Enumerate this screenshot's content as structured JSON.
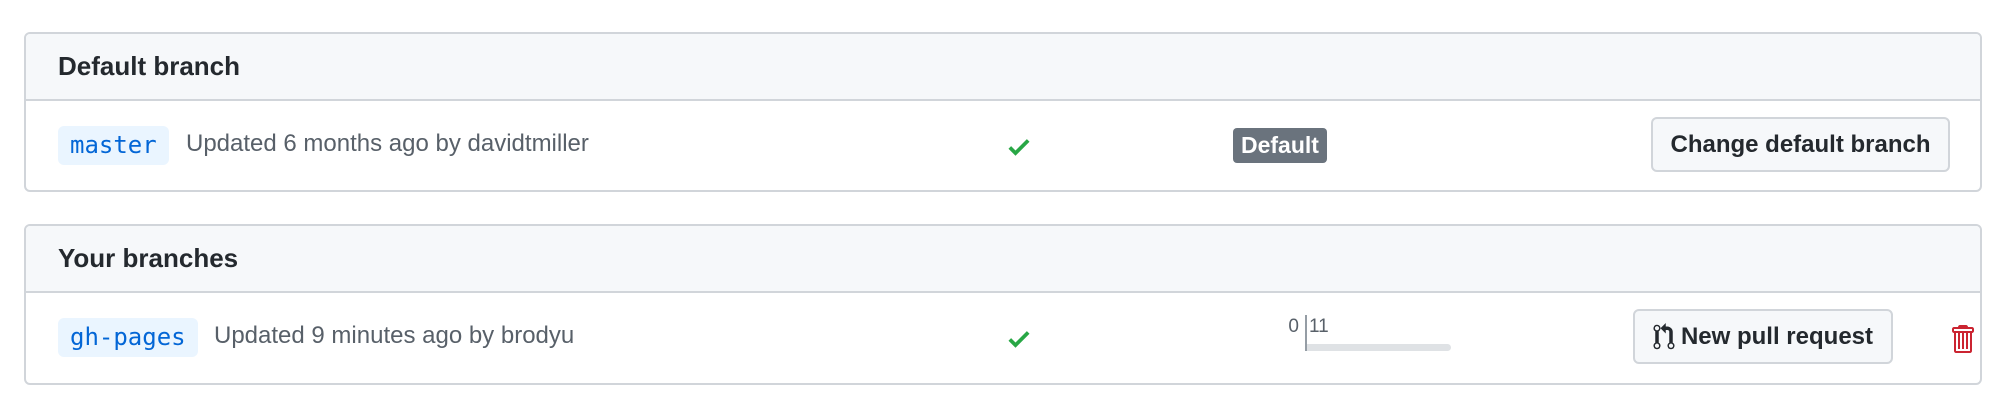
{
  "default_section": {
    "title": "Default branch",
    "branch": {
      "name": "master",
      "updated": "Updated 6 months ago by davidtmiller",
      "status_icon": "check-icon",
      "badge": "Default",
      "action_label": "Change default branch"
    }
  },
  "your_section": {
    "title": "Your branches",
    "branch": {
      "name": "gh-pages",
      "updated": "Updated 9 minutes ago by brodyu",
      "status_icon": "check-icon",
      "behind": "0",
      "ahead": "11",
      "action_label": "New pull request",
      "action_icon": "git-pull-request-icon",
      "delete_icon": "trash-icon"
    }
  },
  "colors": {
    "check": "#28a745",
    "branch_bg": "#eaf5ff",
    "branch_text": "#0366d6",
    "badge_bg": "#6a737d",
    "delete": "#cb2431"
  }
}
